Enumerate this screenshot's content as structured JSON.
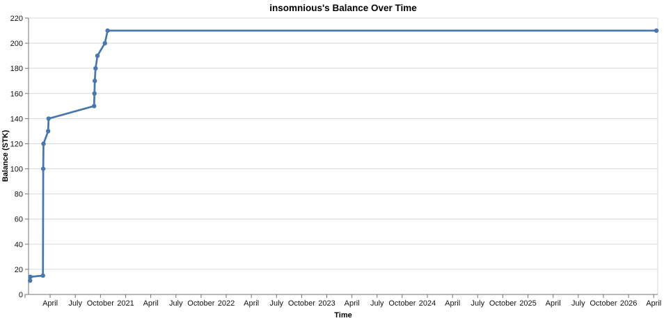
{
  "page": {
    "background_color": "#ffffff"
  },
  "chart_data": {
    "type": "line",
    "title": "insomnious's Balance Over Time",
    "xlabel": "Time",
    "ylabel": "Balance (STK)",
    "ylim": [
      0,
      220
    ],
    "ytick_step": 20,
    "y_tick_labels": [
      "0",
      "20",
      "40",
      "60",
      "80",
      "100",
      "120",
      "140",
      "160",
      "180",
      "200",
      "220"
    ],
    "x_domain": [
      2020.035,
      2026.29
    ],
    "x_ticks": [
      {
        "t": 2020.0,
        "label": ""
      },
      {
        "t": 2020.25,
        "label": "April"
      },
      {
        "t": 2020.5,
        "label": "July"
      },
      {
        "t": 2020.75,
        "label": "October"
      },
      {
        "t": 2021.0,
        "label": "2021"
      },
      {
        "t": 2021.25,
        "label": "April"
      },
      {
        "t": 2021.5,
        "label": "July"
      },
      {
        "t": 2021.75,
        "label": "October"
      },
      {
        "t": 2022.0,
        "label": "2022"
      },
      {
        "t": 2022.25,
        "label": "April"
      },
      {
        "t": 2022.5,
        "label": "July"
      },
      {
        "t": 2022.75,
        "label": "October"
      },
      {
        "t": 2023.0,
        "label": "2023"
      },
      {
        "t": 2023.25,
        "label": "April"
      },
      {
        "t": 2023.5,
        "label": "July"
      },
      {
        "t": 2023.75,
        "label": "October"
      },
      {
        "t": 2024.0,
        "label": "2024"
      },
      {
        "t": 2024.25,
        "label": "April"
      },
      {
        "t": 2024.5,
        "label": "July"
      },
      {
        "t": 2024.75,
        "label": "October"
      },
      {
        "t": 2025.0,
        "label": "2025"
      },
      {
        "t": 2025.25,
        "label": "April"
      },
      {
        "t": 2025.5,
        "label": "July"
      },
      {
        "t": 2025.75,
        "label": "October"
      },
      {
        "t": 2026.0,
        "label": "2026"
      },
      {
        "t": 2026.25,
        "label": "April"
      }
    ],
    "points": [
      {
        "t": 2020.05,
        "v": 11
      },
      {
        "t": 2020.053,
        "v": 14
      },
      {
        "t": 2020.178,
        "v": 15
      },
      {
        "t": 2020.181,
        "v": 100
      },
      {
        "t": 2020.184,
        "v": 120
      },
      {
        "t": 2020.23,
        "v": 130
      },
      {
        "t": 2020.234,
        "v": 140
      },
      {
        "t": 2020.687,
        "v": 150
      },
      {
        "t": 2020.69,
        "v": 160
      },
      {
        "t": 2020.694,
        "v": 170
      },
      {
        "t": 2020.701,
        "v": 180
      },
      {
        "t": 2020.72,
        "v": 190
      },
      {
        "t": 2020.794,
        "v": 200
      },
      {
        "t": 2020.821,
        "v": 210
      },
      {
        "t": 2026.277,
        "v": 210
      }
    ],
    "grid": "horizontal",
    "legend": "none",
    "series_color": "#4a77ad",
    "grid_color": "#d9d9d9",
    "axis_color": "#737373",
    "marker": "circle"
  }
}
